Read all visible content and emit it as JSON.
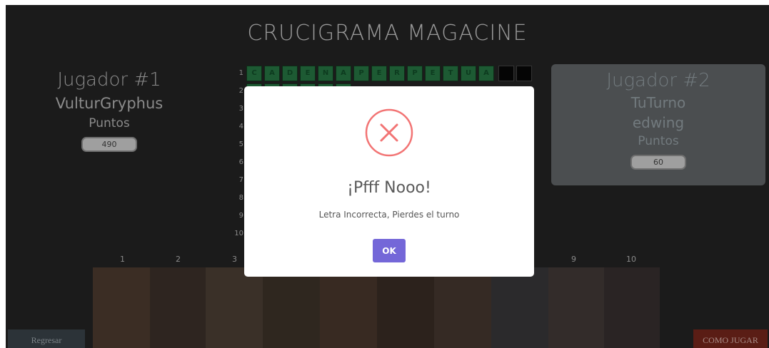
{
  "game": {
    "title": "CRUCIGRAMA MAGACINE"
  },
  "player1": {
    "title": "Jugador #1",
    "name": "VulturGryphus",
    "points_label": "Puntos",
    "score": "490"
  },
  "player2": {
    "title": "Jugador #2",
    "turn": "TuTurno",
    "name": "edwing",
    "points_label": "Puntos",
    "score": "60"
  },
  "crossword": {
    "row_numbers": [
      "1",
      "2",
      "3",
      "4",
      "5",
      "6",
      "7",
      "8",
      "9",
      "10"
    ],
    "row1_letters": [
      "C",
      "A",
      "D",
      "E",
      "N",
      "A",
      "P",
      "E",
      "R",
      "P",
      "E",
      "T",
      "U",
      "A"
    ],
    "column_numbers": [
      "1",
      "2",
      "3",
      "9",
      "10"
    ]
  },
  "buttons": {
    "back": "Regresar",
    "how_to_play": "COMO JUGAR"
  },
  "modal": {
    "icon": "error-x-icon",
    "title": "¡Pfff Nooo!",
    "message": "Letra Incorrecta, Pierdes el turno",
    "ok": "OK"
  },
  "colors": {
    "accent": "#7467d8",
    "error": "#f27474",
    "cell": "#1d5a33",
    "panel": "#4b4e50"
  }
}
